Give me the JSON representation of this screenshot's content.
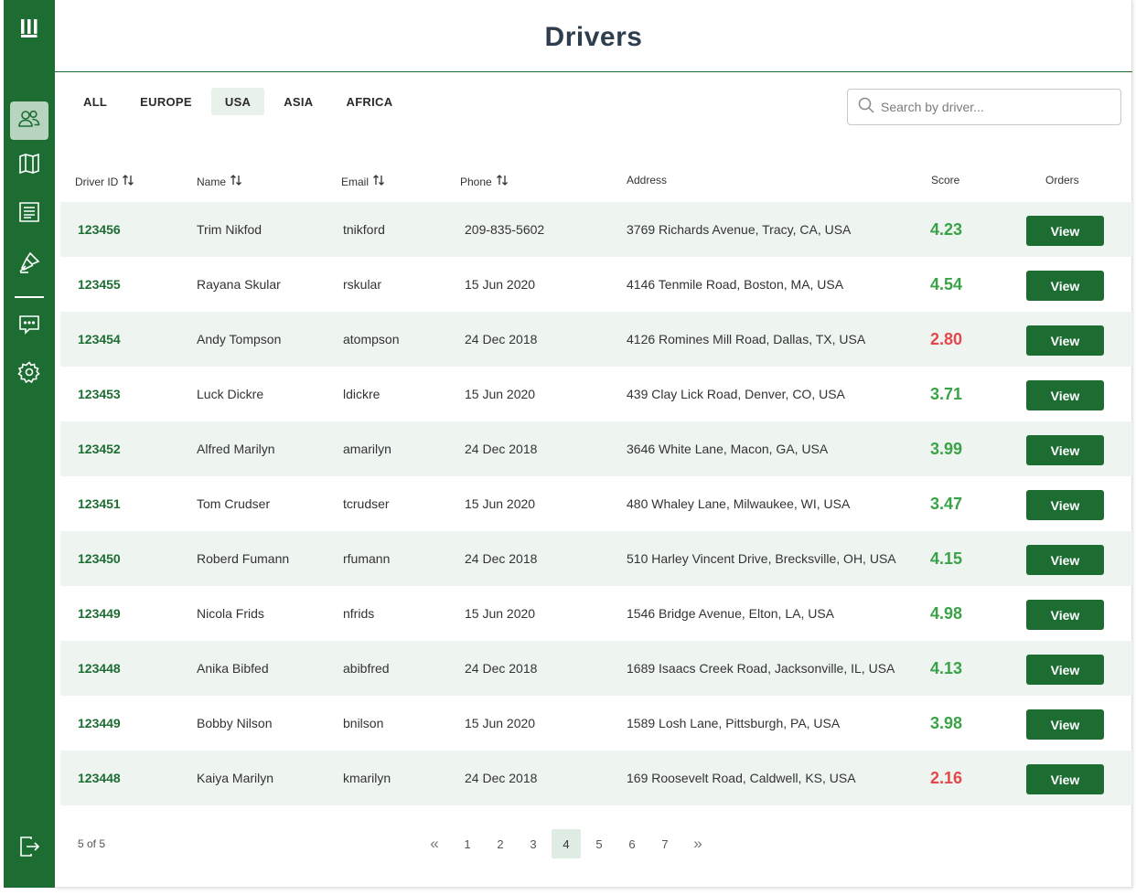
{
  "page": {
    "title": "Drivers"
  },
  "tabs": [
    {
      "label": "ALL",
      "active": false
    },
    {
      "label": "EUROPE",
      "active": false
    },
    {
      "label": "USA",
      "active": true
    },
    {
      "label": "ASIA",
      "active": false
    },
    {
      "label": "AFRICA",
      "active": false
    }
  ],
  "search": {
    "placeholder": "Search by driver...",
    "value": ""
  },
  "table": {
    "columns": [
      "Driver ID",
      "Name",
      "Email",
      "Phone",
      "Address",
      "Score",
      "Orders"
    ],
    "view_label": "View",
    "rows": [
      {
        "id": "123456",
        "name": "Trim Nikfod",
        "email": "tnikford",
        "phone": "209-835-5602",
        "address": "3769  Richards Avenue, Tracy, CA, USA",
        "score": "4.23",
        "status": "good"
      },
      {
        "id": "123455",
        "name": "Rayana Skular",
        "email": "rskular",
        "phone": "15 Jun 2020",
        "address": "4146  Tenmile Road, Boston, MA, USA",
        "score": "4.54",
        "status": "good"
      },
      {
        "id": "123454",
        "name": "Andy Tompson",
        "email": "atompson",
        "phone": "24 Dec 2018",
        "address": "4126  Romines Mill Road, Dallas, TX, USA",
        "score": "2.80",
        "status": "bad"
      },
      {
        "id": "123453",
        "name": "Luck Dickre",
        "email": "ldickre",
        "phone": "15 Jun 2020",
        "address": "439  Clay Lick Road, Denver, CO, USA",
        "score": "3.71",
        "status": "good"
      },
      {
        "id": "123452",
        "name": "Alfred Marilyn",
        "email": "amarilyn",
        "phone": "24 Dec 2018",
        "address": "3646  White Lane, Macon, GA, USA",
        "score": "3.99",
        "status": "good"
      },
      {
        "id": "123451",
        "name": "Tom Crudser",
        "email": "tcrudser",
        "phone": "15 Jun 2020",
        "address": "480  Whaley Lane, Milwaukee, WI, USA",
        "score": "3.47",
        "status": "good"
      },
      {
        "id": "123450",
        "name": "Roberd Fumann",
        "email": "rfumann",
        "phone": "24 Dec 2018",
        "address": "510  Harley Vincent Drive, Brecksville, OH, USA",
        "score": "4.15",
        "status": "good"
      },
      {
        "id": "123449",
        "name": "Nicola Frids",
        "email": "nfrids",
        "phone": "15 Jun 2020",
        "address": "1546  Bridge Avenue, Elton, LA, USA",
        "score": "4.98",
        "status": "good"
      },
      {
        "id": "123448",
        "name": "Anika Bibfed",
        "email": "abibfred",
        "phone": "24 Dec 2018",
        "address": "1689  Isaacs Creek Road, Jacksonville, IL, USA",
        "score": "4.13",
        "status": "good"
      },
      {
        "id": "123449",
        "name": "Bobby Nilson",
        "email": "bnilson",
        "phone": "15 Jun 2020",
        "address": "1589  Losh Lane, Pittsburgh, PA, USA",
        "score": "3.98",
        "status": "good"
      },
      {
        "id": "123448",
        "name": "Kaiya Marilyn",
        "email": "kmarilyn",
        "phone": "24 Dec 2018",
        "address": "169  Roosevelt Road, Caldwell, KS, USA",
        "score": "2.16",
        "status": "bad"
      }
    ]
  },
  "pagination": {
    "info": "5 of 5",
    "first": "«",
    "last": "»",
    "pages": [
      "1",
      "2",
      "3",
      "4",
      "5",
      "6",
      "7"
    ],
    "current": "4"
  },
  "sidebar": {
    "items": [
      {
        "icon": "logo-icon"
      },
      {
        "icon": "drivers-icon",
        "active": true
      },
      {
        "icon": "map-icon"
      },
      {
        "icon": "receipt-icon"
      },
      {
        "icon": "pen-tool-icon"
      },
      {
        "icon": "chat-icon"
      },
      {
        "icon": "settings-icon"
      },
      {
        "icon": "logout-icon"
      }
    ]
  },
  "colors": {
    "brand": "#1d6d33",
    "score_good": "#3aa347",
    "score_bad": "#e5474b",
    "row_alt": "#eef4f0"
  }
}
